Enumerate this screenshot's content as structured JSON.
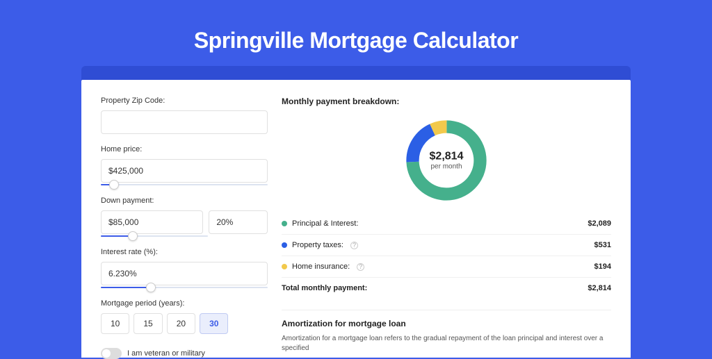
{
  "page_title": "Springville Mortgage Calculator",
  "form": {
    "zip_label": "Property Zip Code:",
    "zip_value": "",
    "home_price_label": "Home price:",
    "home_price_value": "$425,000",
    "down_payment_label": "Down payment:",
    "down_payment_amount": "$85,000",
    "down_payment_pct": "20%",
    "interest_label": "Interest rate (%):",
    "interest_value": "6.230%",
    "period_label": "Mortgage period (years):",
    "periods": [
      "10",
      "15",
      "20",
      "30"
    ],
    "period_active": "30",
    "veteran_label": "I am veteran or military"
  },
  "breakdown": {
    "title": "Monthly payment breakdown:",
    "center_value": "$2,814",
    "center_sub": "per month",
    "rows": [
      {
        "label": "Principal & Interest:",
        "value": "$2,089",
        "color": "#45b08c"
      },
      {
        "label": "Property taxes:",
        "value": "$531",
        "color": "#2b5fe5",
        "info": true
      },
      {
        "label": "Home insurance:",
        "value": "$194",
        "color": "#f2c94c",
        "info": true
      }
    ],
    "total_label": "Total monthly payment:",
    "total_value": "$2,814"
  },
  "amortization": {
    "title": "Amortization for mortgage loan",
    "text": "Amortization for a mortgage loan refers to the gradual repayment of the loan principal and interest over a specified"
  },
  "chart_data": {
    "type": "pie",
    "title": "Monthly payment breakdown",
    "total": 2814,
    "series": [
      {
        "name": "Principal & Interest",
        "value": 2089,
        "color": "#45b08c"
      },
      {
        "name": "Property taxes",
        "value": 531,
        "color": "#2b5fe5"
      },
      {
        "name": "Home insurance",
        "value": 194,
        "color": "#f2c94c"
      }
    ]
  }
}
